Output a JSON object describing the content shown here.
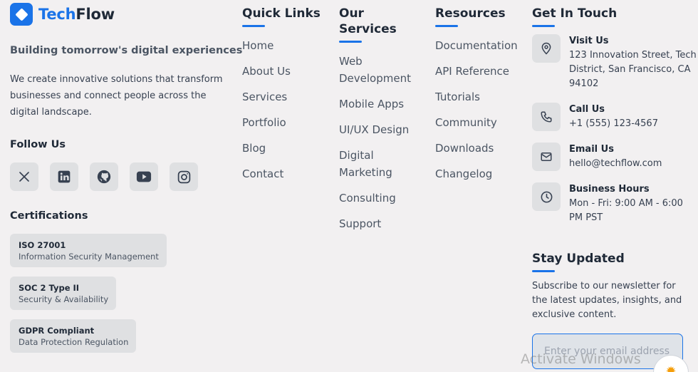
{
  "brand": {
    "name_part1": "Tech",
    "name_part2": "Flow",
    "tagline": "Building tomorrow's digital experiences",
    "description": "We create innovative solutions that transform businesses and connect people across the digital landscape."
  },
  "follow": {
    "title": "Follow Us",
    "icons": [
      "x-icon",
      "linkedin-icon",
      "github-icon",
      "youtube-icon",
      "instagram-icon"
    ]
  },
  "certifications": {
    "title": "Certifications",
    "items": [
      {
        "title": "ISO 27001",
        "subtitle": "Information Security Management"
      },
      {
        "title": "SOC 2 Type II",
        "subtitle": "Security & Availability"
      },
      {
        "title": "GDPR Compliant",
        "subtitle": "Data Protection Regulation"
      }
    ]
  },
  "quick_links": {
    "title": "Quick Links",
    "items": [
      "Home",
      "About Us",
      "Services",
      "Portfolio",
      "Blog",
      "Contact"
    ]
  },
  "services": {
    "title": "Our Services",
    "items": [
      "Web Development",
      "Mobile Apps",
      "UI/UX Design",
      "Digital Marketing",
      "Consulting",
      "Support"
    ]
  },
  "resources": {
    "title": "Resources",
    "items": [
      "Documentation",
      "API Reference",
      "Tutorials",
      "Community",
      "Downloads",
      "Changelog"
    ]
  },
  "contact": {
    "title": "Get In Touch",
    "items": [
      {
        "icon": "map-pin-icon",
        "label": "Visit Us",
        "value": "123 Innovation Street, Tech District, San Francisco, CA 94102"
      },
      {
        "icon": "phone-icon",
        "label": "Call Us",
        "value": "+1 (555) 123-4567"
      },
      {
        "icon": "mail-icon",
        "label": "Email Us",
        "value": "hello@techflow.com"
      },
      {
        "icon": "clock-icon",
        "label": "Business Hours",
        "value": "Mon - Fri: 9:00 AM - 6:00 PM PST"
      }
    ]
  },
  "newsletter": {
    "title": "Stay Updated",
    "description": "Subscribe to our newsletter for the latest updates, insights, and exclusive content.",
    "placeholder": "Enter your email address"
  },
  "overlay": {
    "watermark": "Activate Windows"
  },
  "colors": {
    "accent": "#1a73e8",
    "background": "#f2f0f1",
    "chip": "#dfe0e2"
  }
}
